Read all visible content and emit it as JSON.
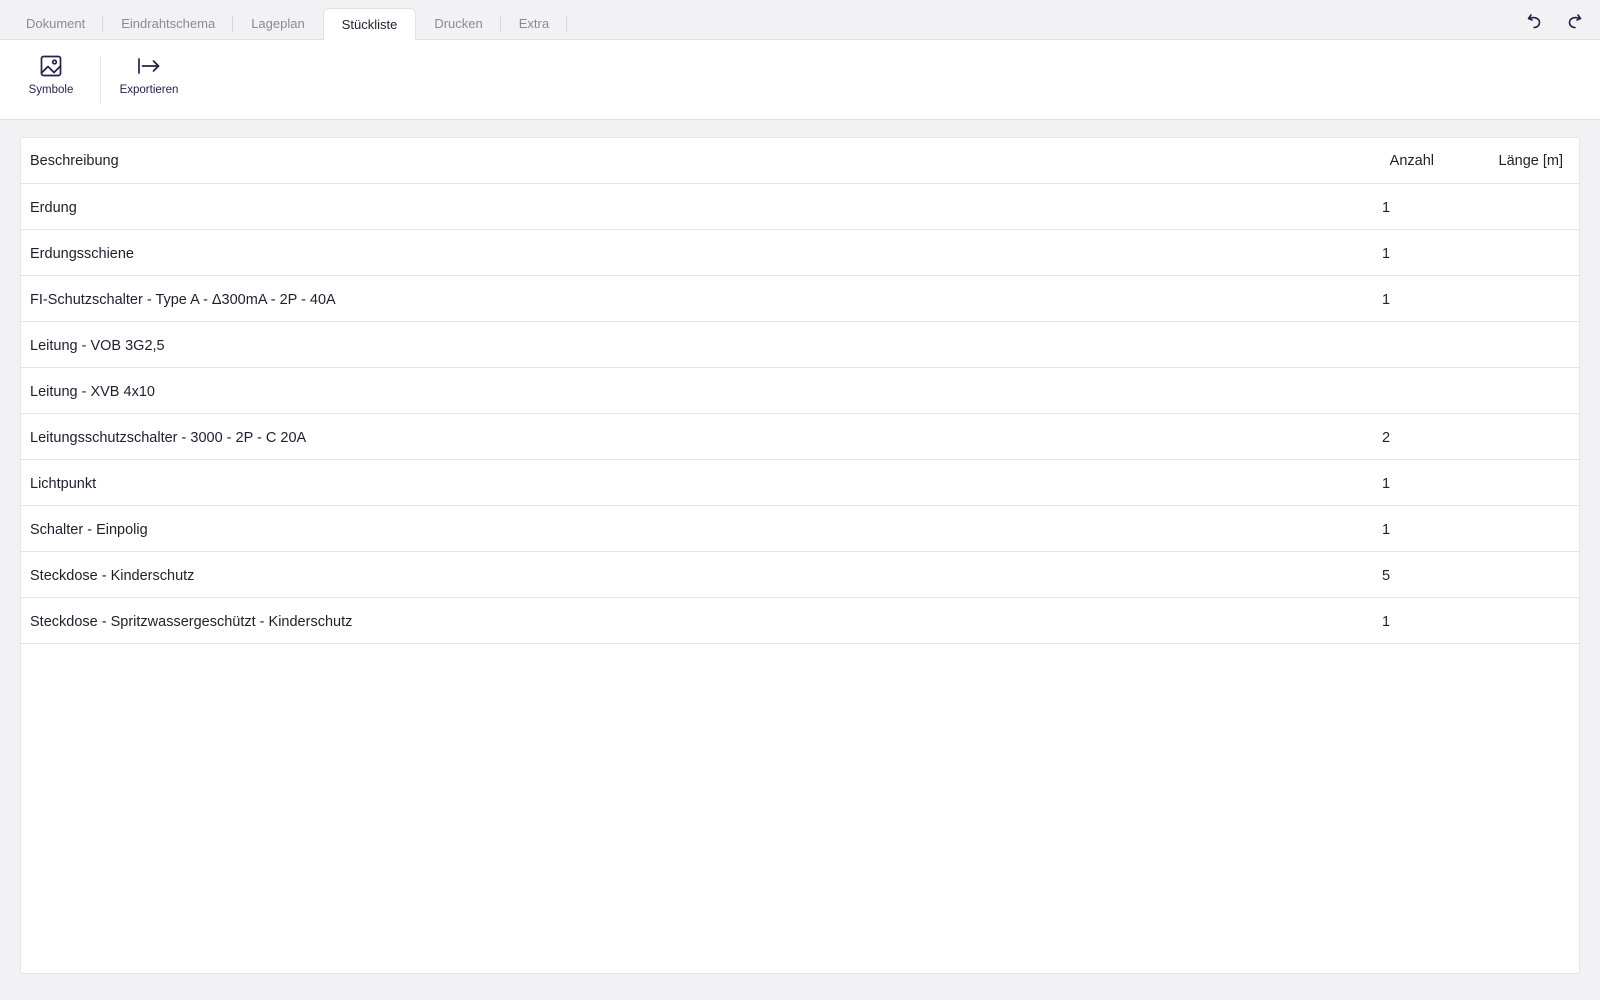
{
  "tabs": [
    {
      "label": "Dokument",
      "active": false
    },
    {
      "label": "Eindrahtschema",
      "active": false
    },
    {
      "label": "Lageplan",
      "active": false
    },
    {
      "label": "Stückliste",
      "active": true
    },
    {
      "label": "Drucken",
      "active": false
    },
    {
      "label": "Extra",
      "active": false
    }
  ],
  "history": {
    "undo_icon": "undo-icon",
    "redo_icon": "redo-icon"
  },
  "toolbar": {
    "symbols_label": "Symbole",
    "symbols_icon": "image-icon",
    "export_label": "Exportieren",
    "export_icon": "export-arrow-icon"
  },
  "table": {
    "columns": {
      "description": "Beschreibung",
      "count": "Anzahl",
      "length": "Länge [m]"
    },
    "rows": [
      {
        "description": "Erdung",
        "count": "1",
        "length": ""
      },
      {
        "description": "Erdungsschiene",
        "count": "1",
        "length": ""
      },
      {
        "description": "FI-Schutzschalter - Type A - Δ300mA - 2P - 40A",
        "count": "1",
        "length": ""
      },
      {
        "description": "Leitung - VOB 3G2,5",
        "count": "",
        "length": ""
      },
      {
        "description": "Leitung - XVB 4x10",
        "count": "",
        "length": ""
      },
      {
        "description": "Leitungsschutzschalter - 3000 - 2P - C 20A",
        "count": "2",
        "length": ""
      },
      {
        "description": "Lichtpunkt",
        "count": "1",
        "length": ""
      },
      {
        "description": "Schalter - Einpolig",
        "count": "1",
        "length": ""
      },
      {
        "description": "Steckdose - Kinderschutz",
        "count": "5",
        "length": ""
      },
      {
        "description": "Steckdose - Spritzwassergeschützt - Kinderschutz",
        "count": "1",
        "length": ""
      }
    ]
  },
  "colors": {
    "accent": "#23234a",
    "background": "#f2f2f4",
    "border": "#e4e4ea"
  }
}
